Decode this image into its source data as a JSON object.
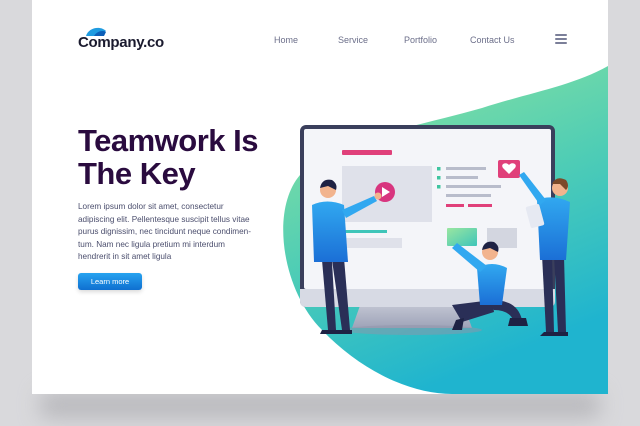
{
  "brand": {
    "name": "Company.co"
  },
  "nav": {
    "items": [
      "Home",
      "Service",
      "Portfolio",
      "Contact Us"
    ]
  },
  "icons": {
    "logo": "logo-mark-icon",
    "menu": "hamburger-menu-icon",
    "play": "play-icon",
    "heart": "heart-icon"
  },
  "hero": {
    "title_line1": "Teamwork Is",
    "title_line2": "The Key",
    "body_lines": [
      "Lorem ipsum dolor sit amet, consectetur",
      "adipiscing elit. Pellentesque suscipit tellus vitae",
      "purus dignissim, nec tincidunt neque condimen-",
      "tum. Nam nec ligula pretium mi interdum",
      "hendrerit in sit amet ligula"
    ],
    "cta_label": "Learn more"
  },
  "colors": {
    "title": "#2a0b3f",
    "accent_blue": "#1a8fe3",
    "gradient_start": "#8fe39a",
    "gradient_end": "#26b8c9",
    "monitor_frame": "#3a3f5c",
    "pink": "#e0407a"
  }
}
